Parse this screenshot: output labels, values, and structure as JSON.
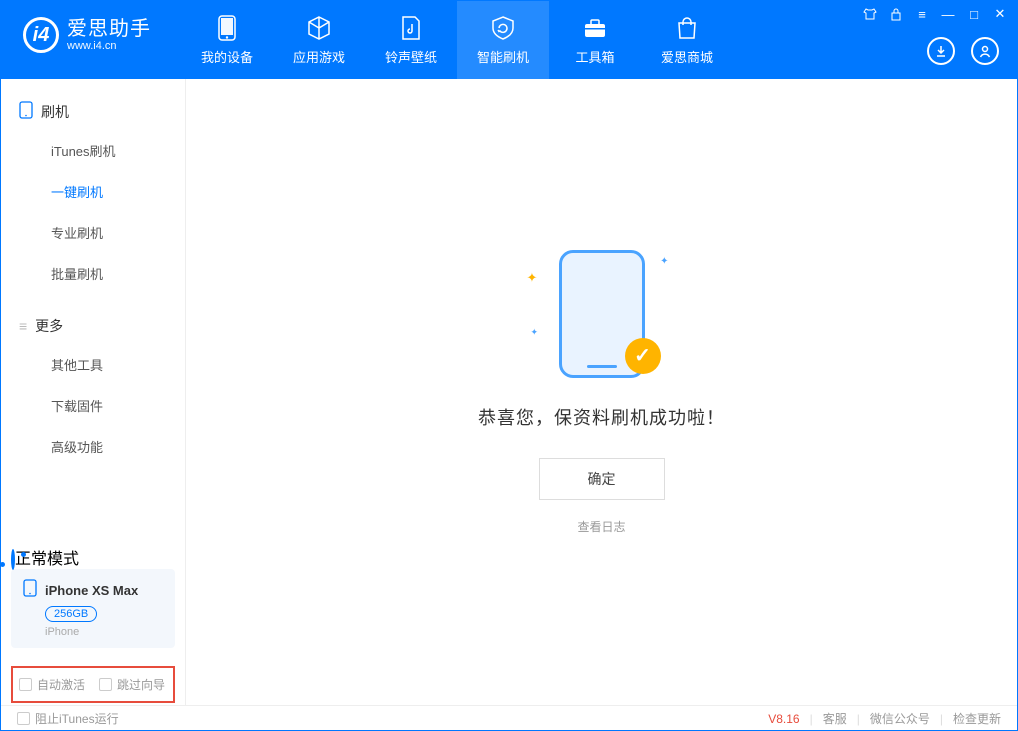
{
  "app": {
    "title": "爱思助手",
    "url": "www.i4.cn"
  },
  "nav": {
    "items": [
      {
        "label": "我的设备"
      },
      {
        "label": "应用游戏"
      },
      {
        "label": "铃声壁纸"
      },
      {
        "label": "智能刷机"
      },
      {
        "label": "工具箱"
      },
      {
        "label": "爱思商城"
      }
    ],
    "active_index": 3
  },
  "sidebar": {
    "section1": {
      "title": "刷机",
      "items": [
        "iTunes刷机",
        "一键刷机",
        "专业刷机",
        "批量刷机"
      ],
      "active_index": 1
    },
    "section2": {
      "title": "更多",
      "items": [
        "其他工具",
        "下载固件",
        "高级功能"
      ]
    }
  },
  "device_panel": {
    "mode": "正常模式",
    "name": "iPhone XS Max",
    "capacity": "256GB",
    "type": "iPhone"
  },
  "options": {
    "auto_activate": "自动激活",
    "skip_guide": "跳过向导"
  },
  "main": {
    "success_title": "恭喜您，保资料刷机成功啦！",
    "ok_button": "确定",
    "view_log": "查看日志"
  },
  "footer": {
    "block_itunes": "阻止iTunes运行",
    "version": "V8.16",
    "links": [
      "客服",
      "微信公众号",
      "检查更新"
    ]
  }
}
